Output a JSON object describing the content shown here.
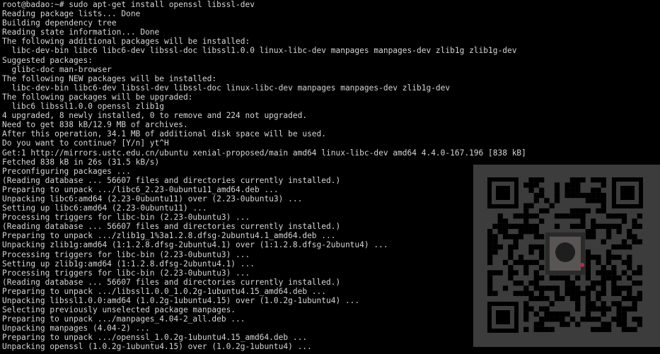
{
  "terminal": {
    "lines": [
      "root@badao:~# sudo apt-get install openssl libssl-dev",
      "Reading package lists... Done",
      "Building dependency tree",
      "Reading state information... Done",
      "The following additional packages will be installed:",
      "  libc-dev-bin libc6 libc6-dev libssl-doc libssl1.0.0 linux-libc-dev manpages manpages-dev zlib1g zlib1g-dev",
      "Suggested packages:",
      "  glibc-doc man-browser",
      "The following NEW packages will be installed:",
      "  libc-dev-bin libc6-dev libssl-dev libssl-doc linux-libc-dev manpages manpages-dev zlib1g-dev",
      "The following packages will be upgraded:",
      "  libc6 libssl1.0.0 openssl zlib1g",
      "4 upgraded, 8 newly installed, 0 to remove and 224 not upgraded.",
      "Need to get 838 kB/12.9 MB of archives.",
      "After this operation, 34.1 MB of additional disk space will be used.",
      "Do you want to continue? [Y/n] yt^H",
      "Get:1 http://mirrors.ustc.edu.cn/ubuntu xenial-proposed/main amd64 linux-libc-dev amd64 4.4.0-167.196 [838 kB]",
      "Fetched 838 kB in 26s (31.5 kB/s)",
      "Preconfiguring packages ...",
      "(Reading database ... 56607 files and directories currently installed.)",
      "Preparing to unpack .../libc6_2.23-0ubuntu11_amd64.deb ...",
      "Unpacking libc6:amd64 (2.23-0ubuntu11) over (2.23-0ubuntu3) ...",
      "Setting up libc6:amd64 (2.23-0ubuntu11) ...",
      "Processing triggers for libc-bin (2.23-0ubuntu3) ...",
      "(Reading database ... 56607 files and directories currently installed.)",
      "Preparing to unpack .../zlib1g_1%3a1.2.8.dfsg-2ubuntu4.1_amd64.deb ...",
      "Unpacking zlib1g:amd64 (1:1.2.8.dfsg-2ubuntu4.1) over (1:1.2.8.dfsg-2ubuntu4) ...",
      "Processing triggers for libc-bin (2.23-0ubuntu3) ...",
      "Setting up zlib1g:amd64 (1:1.2.8.dfsg-2ubuntu4.1) ...",
      "Processing triggers for libc-bin (2.23-0ubuntu3) ...",
      "(Reading database ... 56607 files and directories currently installed.)",
      "Preparing to unpack .../libssl1.0.0_1.0.2g-1ubuntu4.15_amd64.deb ...",
      "Unpacking libssl1.0.0:amd64 (1.0.2g-1ubuntu4.15) over (1.0.2g-1ubuntu4) ...",
      "Selecting previously unselected package manpages.",
      "Preparing to unpack .../manpages_4.04-2_all.deb ...",
      "Unpacking manpages (4.04-2) ...",
      "Preparing to unpack .../openssl_1.0.2g-1ubuntu4.15_amd64.deb ...",
      "Unpacking openssl (1.0.2g-1ubuntu4.15) over (1.0.2g-1ubuntu4) ..."
    ]
  },
  "overlay": {
    "qr_icon": "qr-code-icon",
    "panel_color": "#3c3c3c",
    "module_color": "#000000",
    "text_color": "#d6d6d6"
  }
}
